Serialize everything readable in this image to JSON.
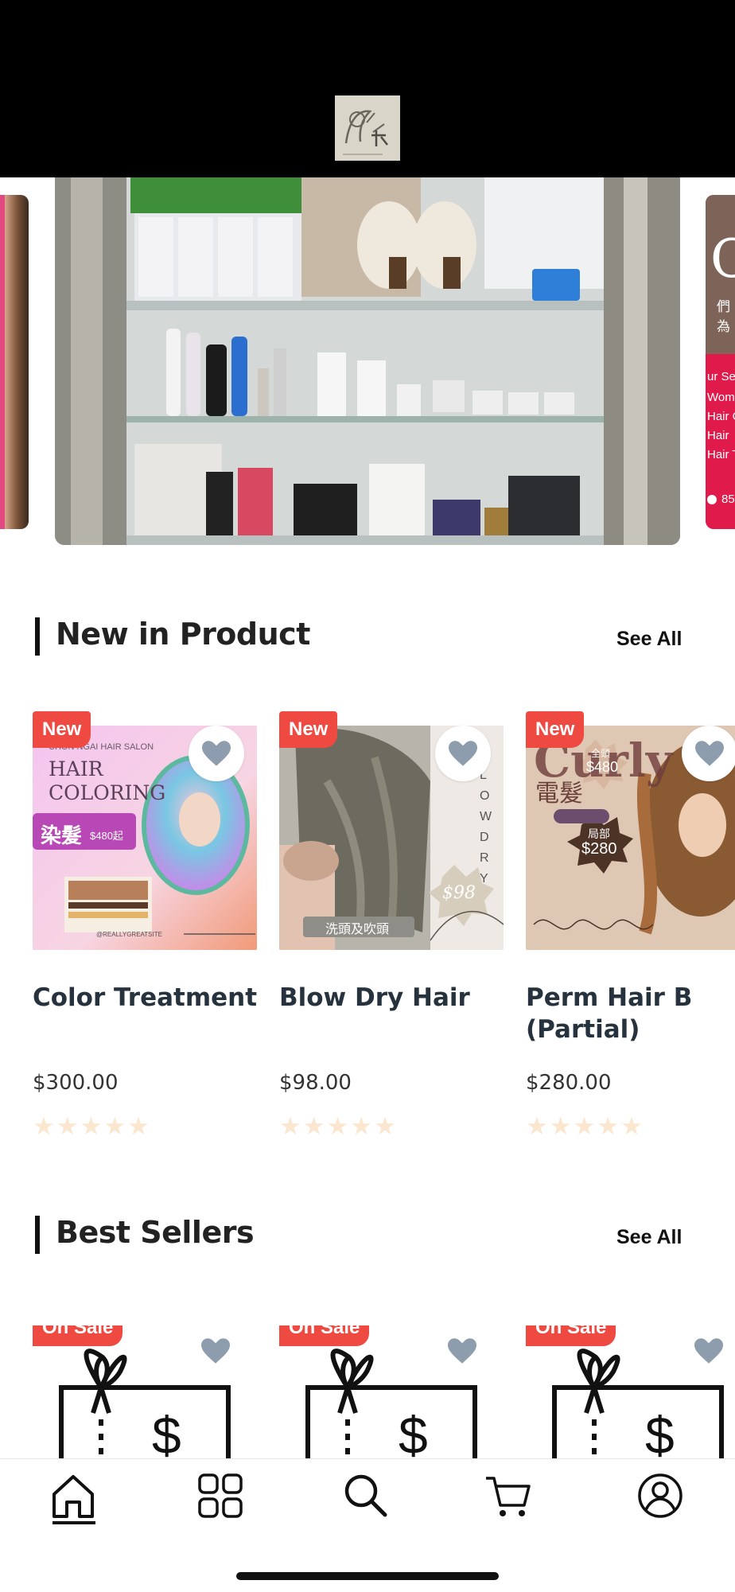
{
  "header": {
    "logo_icon": "salon-logo-icon"
  },
  "carousel": {
    "right_slide": {
      "big": "Ch",
      "cn": "們為",
      "lines": [
        "ur Se",
        "Wom",
        "Hair C",
        "Hair",
        "Hair T"
      ],
      "number": "85"
    }
  },
  "new_in_product": {
    "title": "New in Product",
    "see_all": "See All",
    "cards": [
      {
        "badge": "New",
        "name_lines": [
          "Color Treatment"
        ],
        "price": "$300.00",
        "stars": "★★★★★",
        "img": {
          "brand": "CHON NGAI HAIR SALON",
          "l1": "HAIR",
          "l2": "COLORING",
          "cn": "染髮",
          "price": "$480起",
          "site": "@REALLYGREATSITE"
        }
      },
      {
        "badge": "New",
        "name_lines": [
          "Blow Dry Hair"
        ],
        "price": "$98.00",
        "stars": "★★★★★",
        "img": {
          "vertical": "LOW DRY",
          "tag_price": "$98",
          "cn": "洗頭及吹頭"
        }
      },
      {
        "badge": "New",
        "name_lines": [
          "Perm Hair B",
          "(Partial)"
        ],
        "price": "$280.00",
        "stars": "★★★★★",
        "img": {
          "script": "Curly",
          "cn": "電髮",
          "burst1_l1": "局部",
          "burst1_l2": "$280",
          "burst2": "$480",
          "burst2_cn": "全頭"
        }
      }
    ]
  },
  "best_sellers": {
    "title": "Best Sellers",
    "see_all": "See All",
    "cards": [
      {
        "badge": "On Sale",
        "symbol": "$"
      },
      {
        "badge": "On Sale",
        "symbol": "$"
      },
      {
        "badge": "On Sale",
        "symbol": "$"
      }
    ]
  },
  "tabbar": {
    "items": [
      {
        "icon": "home-icon",
        "active": true
      },
      {
        "icon": "grid-icon",
        "active": false
      },
      {
        "icon": "search-icon",
        "active": false
      },
      {
        "icon": "cart-icon",
        "active": false
      },
      {
        "icon": "profile-icon",
        "active": false
      }
    ]
  },
  "colors": {
    "badge": "#ef4a42",
    "heart": "#8e9dad",
    "star": "#fbe6cf",
    "header": "#000000"
  }
}
